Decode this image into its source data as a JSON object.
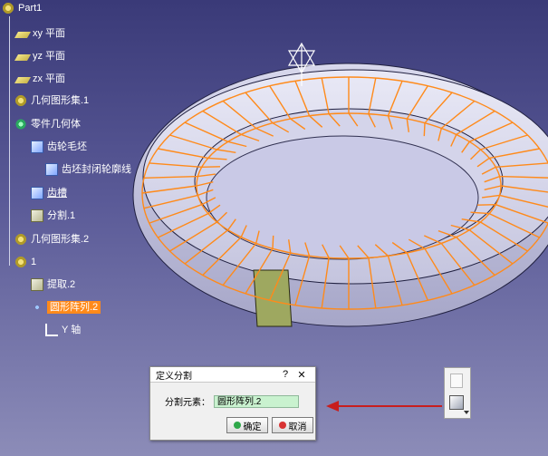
{
  "tree": {
    "root": "Part1",
    "nodes": [
      {
        "label": "xy 平面"
      },
      {
        "label": "yz 平面"
      },
      {
        "label": "zx 平面"
      },
      {
        "label": "几何图形集.1"
      },
      {
        "label": "零件几何体"
      },
      {
        "label": "齿轮毛坯"
      },
      {
        "label": "齿坯封闭轮廓线"
      },
      {
        "label": "齿槽"
      },
      {
        "label": "分割.1"
      },
      {
        "label": "几何图形集.2"
      },
      {
        "label": "1"
      },
      {
        "label": "提取.2"
      },
      {
        "label": "圆形阵列.2"
      },
      {
        "label": "Y 轴"
      }
    ]
  },
  "dialog": {
    "title": "定义分割",
    "help": "?",
    "close": "✕",
    "field_label": "分割元素：",
    "field_value": "圆形阵列.2",
    "ok_label": "确定",
    "cancel_label": "取消"
  },
  "colors": {
    "background_top": "#3a3a78",
    "selection": "#ff8a1a",
    "pattern_lines": "#ff8a1a",
    "field_green": "#c9f2cf",
    "arrow_red": "#c81e1e"
  }
}
